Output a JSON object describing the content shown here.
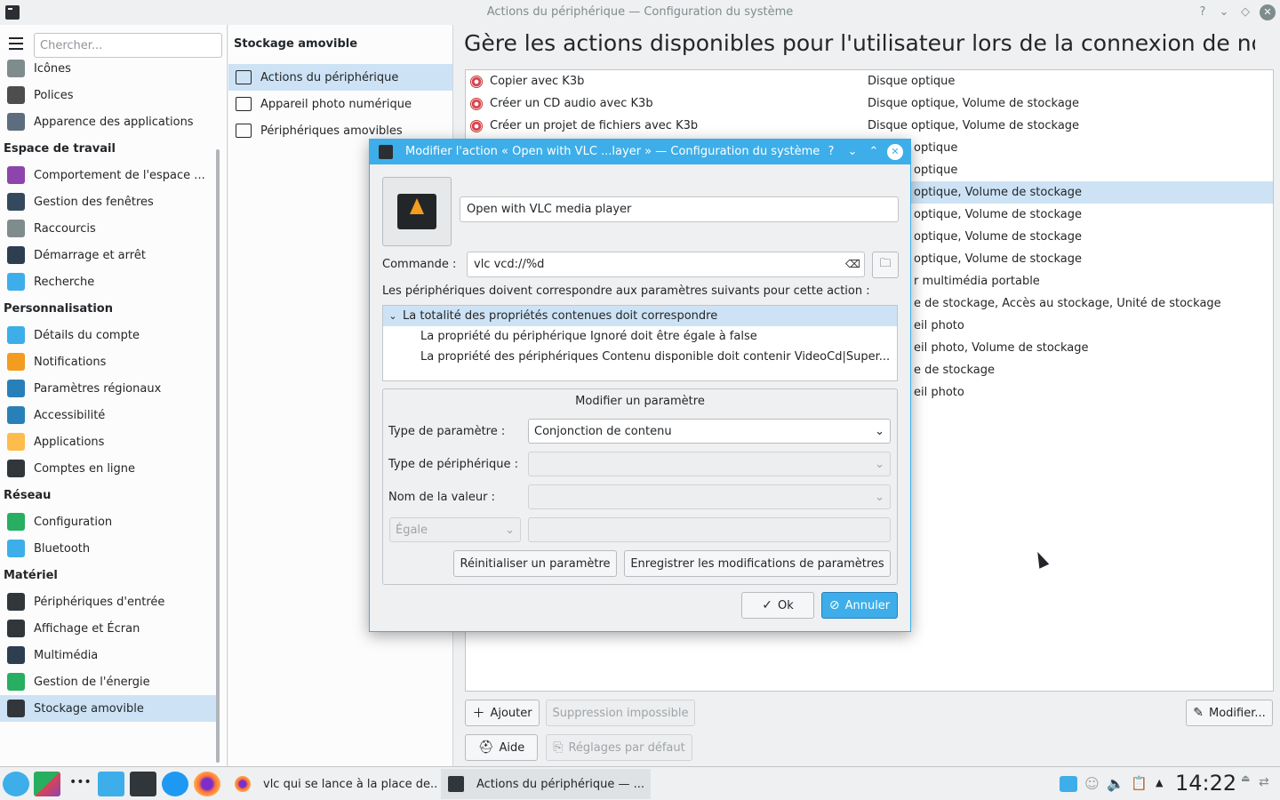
{
  "window": {
    "title": "Actions du périphérique — Configuration du système",
    "buttons": {
      "help": "?",
      "minimize": "⌄",
      "maximize": "◇",
      "close": "✕"
    }
  },
  "sidebar": {
    "search_placeholder": "Chercher...",
    "rows": [
      {
        "type": "item",
        "label": "Icônes",
        "icon": "icons-icon",
        "color": "#7f8c8d"
      },
      {
        "type": "item",
        "label": "Polices",
        "icon": "fonts-icon",
        "color": "#4d4d4d"
      },
      {
        "type": "item",
        "label": "Apparence des applications",
        "icon": "app-style-icon",
        "color": "#5d6d7e"
      },
      {
        "type": "cat",
        "label": "Espace de travail"
      },
      {
        "type": "item",
        "label": "Comportement de l'espace ...",
        "icon": "workspace-behavior-icon",
        "color": "#8e44ad"
      },
      {
        "type": "item",
        "label": "Gestion des fenêtres",
        "icon": "window-management-icon",
        "color": "#34495e"
      },
      {
        "type": "item",
        "label": "Raccourcis",
        "icon": "keyboard-icon",
        "color": "#7f8c8d"
      },
      {
        "type": "item",
        "label": "Démarrage et arrêt",
        "icon": "startup-shutdown-icon",
        "color": "#2c3e50"
      },
      {
        "type": "item",
        "label": "Recherche",
        "icon": "search-icon",
        "color": "#3daee9"
      },
      {
        "type": "cat",
        "label": "Personnalisation"
      },
      {
        "type": "item",
        "label": "Détails du compte",
        "icon": "account-icon",
        "color": "#3daee9"
      },
      {
        "type": "item",
        "label": "Notifications",
        "icon": "bell-icon",
        "color": "#f39c1f"
      },
      {
        "type": "item",
        "label": "Paramètres régionaux",
        "icon": "regional-icon",
        "color": "#2980b9"
      },
      {
        "type": "item",
        "label": "Accessibilité",
        "icon": "accessibility-icon",
        "color": "#2980b9"
      },
      {
        "type": "item",
        "label": "Applications",
        "icon": "star-icon",
        "color": "#fdbc4b"
      },
      {
        "type": "item",
        "label": "Comptes en ligne",
        "icon": "online-accounts-icon",
        "color": "#31363b"
      },
      {
        "type": "cat",
        "label": "Réseau"
      },
      {
        "type": "item",
        "label": "Configuration",
        "icon": "globe-icon",
        "color": "#27ae60"
      },
      {
        "type": "item",
        "label": "Bluetooth",
        "icon": "bluetooth-icon",
        "color": "#3daee9"
      },
      {
        "type": "cat",
        "label": "Matériel"
      },
      {
        "type": "item",
        "label": "Périphériques d'entrée",
        "icon": "input-devices-icon",
        "color": "#31363b"
      },
      {
        "type": "item",
        "label": "Affichage et Écran",
        "icon": "display-icon",
        "color": "#31363b"
      },
      {
        "type": "item",
        "label": "Multimédia",
        "icon": "multimedia-icon",
        "color": "#2c3e50"
      },
      {
        "type": "item",
        "label": "Gestion de l'énergie",
        "icon": "power-icon",
        "color": "#27ae60"
      },
      {
        "type": "item",
        "label": "Stockage amovible",
        "icon": "removable-storage-icon",
        "color": "#31363b",
        "selected": true
      }
    ]
  },
  "middle": {
    "title": "Stockage amovible",
    "items": [
      {
        "label": "Actions du périphérique",
        "icon": "device-actions-icon",
        "selected": true
      },
      {
        "label": "Appareil photo numérique",
        "icon": "camera-icon"
      },
      {
        "label": "Périphériques amovibles",
        "icon": "usb-icon"
      }
    ]
  },
  "main": {
    "heading": "Gère les actions disponibles pour l'utilisateur lors de la connexion de nouv",
    "actions": [
      {
        "name": "Copier avec K3b",
        "devices": "Disque optique"
      },
      {
        "name": "Créer un CD audio avec K3b",
        "devices": "Disque optique, Volume de stockage"
      },
      {
        "name": "Créer un projet de fichiers avec K3b",
        "devices": "Disque optique, Volume de stockage"
      },
      {
        "name": "",
        "devices": "optique"
      },
      {
        "name": "",
        "devices": "optique"
      },
      {
        "name": "",
        "devices": "optique, Volume de stockage",
        "selected": true
      },
      {
        "name": "",
        "devices": "optique, Volume de stockage"
      },
      {
        "name": "",
        "devices": "optique, Volume de stockage"
      },
      {
        "name": "",
        "devices": "optique, Volume de stockage"
      },
      {
        "name": "",
        "devices": "r multimédia portable"
      },
      {
        "name": "",
        "devices": "e de stockage, Accès au stockage, Unité de stockage"
      },
      {
        "name": "",
        "devices": "eil photo"
      },
      {
        "name": "",
        "devices": "eil photo, Volume de stockage"
      },
      {
        "name": "",
        "devices": "e de stockage"
      },
      {
        "name": "",
        "devices": "eil photo"
      }
    ],
    "buttons": {
      "add": "Ajouter",
      "remove": "Suppression impossible",
      "edit": "Modifier...",
      "help": "Aide",
      "defaults": "Réglages par défaut"
    }
  },
  "dialog": {
    "title": "Modifier l'action « Open with VLC ...layer » — Configuration du système",
    "action_name": "Open with VLC media player",
    "command_label": "Commande :",
    "command_value": "vlc vcd://%d",
    "match_label": "Les périphériques doivent correspondre aux paramètres suivants pour cette action :",
    "tree": [
      "La totalité des propriétés contenues doit correspondre",
      "La propriété du périphérique Ignoré doit être égale à false",
      "La propriété des périphériques Contenu disponible doit contenir VideoCd|Super..."
    ],
    "group_title": "Modifier un paramètre",
    "param_type_label": "Type de paramètre :",
    "param_type_value": "Conjonction de contenu",
    "device_type_label": "Type de périphérique :",
    "value_name_label": "Nom de la valeur :",
    "operator_value": "Égale",
    "reset_button": "Réinitialiser un paramètre",
    "save_button": "Enregistrer les modifications de paramètres",
    "ok_button": "Ok",
    "cancel_button": "Annuler"
  },
  "taskbar": {
    "tasks": [
      {
        "label": "vlc qui se lance à la place de...",
        "icon": "firefox-icon"
      },
      {
        "label": "Actions du périphérique — ...",
        "icon": "system-settings-icon",
        "active": true
      }
    ],
    "clock": "14:22"
  },
  "colors": {
    "accent": "#3daee9",
    "selection": "#cde3f5"
  }
}
